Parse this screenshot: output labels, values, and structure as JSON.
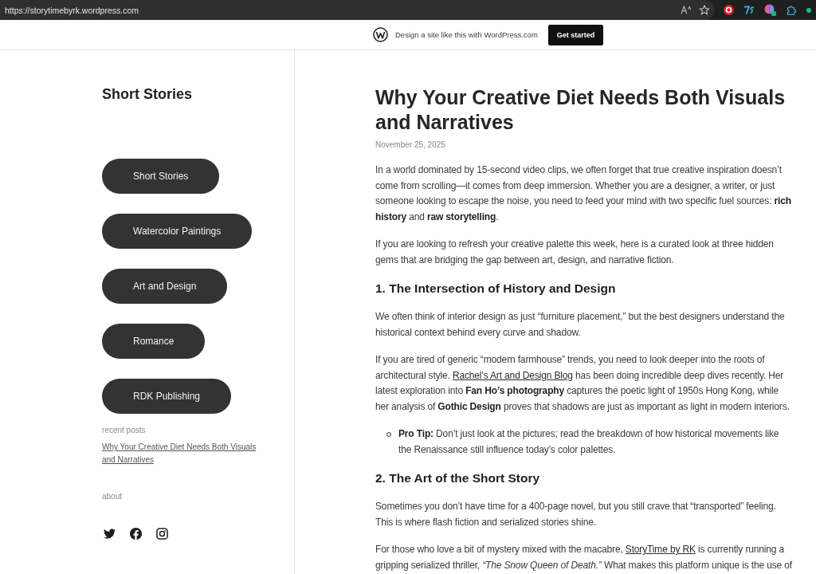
{
  "browser": {
    "url": "https://storytimebyrk.wordpress.com"
  },
  "banner": {
    "text": "Design a site like this with WordPress.com",
    "button": "Get started"
  },
  "sidebar": {
    "site_title": "Short Stories",
    "nav": [
      "Short Stories",
      "Watercolor Paintings",
      "Art and Design",
      "Romance",
      "RDK Publishing"
    ],
    "recent_posts": {
      "heading": "recent posts",
      "links": [
        "Why Your Creative Diet Needs Both Visuals and Narratives"
      ]
    },
    "about": {
      "heading": "about"
    }
  },
  "post": {
    "title": "Why Your Creative Diet Needs Both Visuals and Narratives",
    "date": "November 25, 2025",
    "blocks": [
      {
        "kind": "paragraph",
        "parts": [
          {
            "kind": "text",
            "text": "In a world dominated by 15-second video clips, we often forget that true creative inspiration doesn’t come from scrolling—it comes from deep immersion. Whether you are a designer, a writer, or just someone looking to escape the noise, you need to feed your mind with two specific fuel sources: **rich history** and **raw storytelling**."
          }
        ]
      },
      {
        "kind": "paragraph",
        "parts": [
          {
            "kind": "text",
            "text": "If you are looking to refresh your creative palette this week, here is a curated look at three hidden gems that are bridging the gap between art, design, and narrative fiction."
          }
        ]
      },
      {
        "kind": "heading",
        "text": "1. The Intersection of History and Design"
      },
      {
        "kind": "paragraph",
        "parts": [
          {
            "kind": "text",
            "text": "We often think of interior design as just “furniture placement,” but the best designers understand the historical context behind every curve and shadow."
          }
        ]
      },
      {
        "kind": "paragraph",
        "parts": [
          {
            "kind": "text",
            "text": "If you are tired of generic “modern farmhouse” trends, you need to look deeper into the roots of architectural style. "
          },
          {
            "kind": "link",
            "text": "Rachel’s Art and Design Blog"
          },
          {
            "kind": "text",
            "text": " has been doing incredible deep dives recently. Her latest exploration into **Fan Ho’s photography** captures the poetic light of 1950s Hong Kong, while her analysis of **Gothic Design** proves that shadows are just as important as light in modern interiors."
          }
        ]
      },
      {
        "kind": "list",
        "items": [
          {
            "parts": [
              {
                "kind": "text",
                "text": "**Pro Tip:** Don’t just look at the pictures; read the breakdown of how historical movements like the Renaissance still influence today’s color palettes."
              }
            ]
          }
        ]
      },
      {
        "kind": "heading",
        "text": "2. The Art of the Short Story"
      },
      {
        "kind": "paragraph",
        "parts": [
          {
            "kind": "text",
            "text": "Sometimes you don’t have time for a 400-page novel, but you still crave that “transported” feeling. This is where flash fiction and serialized stories shine."
          }
        ]
      },
      {
        "kind": "paragraph",
        "parts": [
          {
            "kind": "text",
            "text": "For those who love a bit of mystery mixed with the macabre, "
          },
          {
            "kind": "link",
            "text": "StoryTime by RK"
          },
          {
            "kind": "text",
            "text": " is currently running a gripping serialized thriller, *“The Snow Queen of Death.”* What makes this platform unique is the use of"
          }
        ]
      }
    ]
  }
}
